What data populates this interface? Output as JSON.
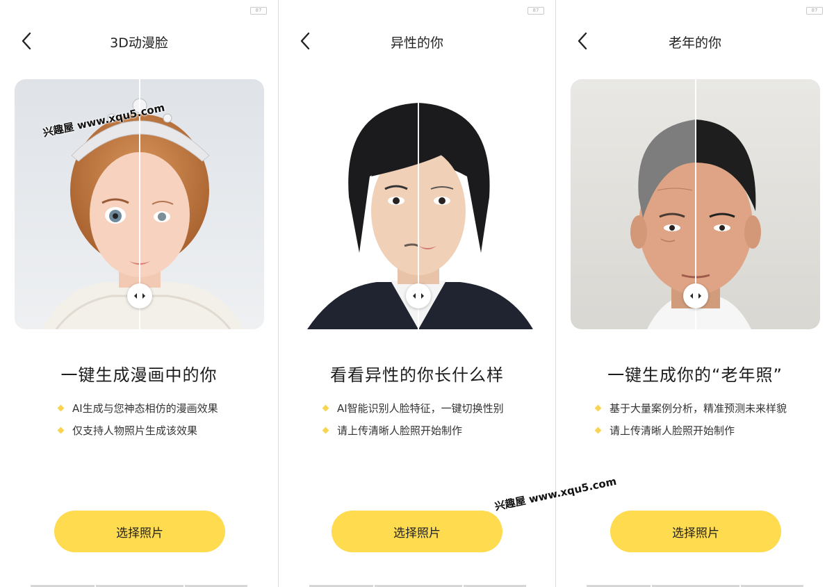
{
  "watermark_text": "兴趣屋 www.xqu5.com",
  "accent_color": "#fedb4f",
  "screens": [
    {
      "status_badge": "87",
      "title": "3D动漫脸",
      "headline": "一键生成漫画中的你",
      "bullets": [
        "AI生成与您神态相仿的漫画效果",
        "仅支持人物照片生成该效果"
      ],
      "button_label": "选择照片",
      "comparison_position": 0.5
    },
    {
      "status_badge": "87",
      "title": "异性的你",
      "headline": "看看异性的你长什么样",
      "bullets": [
        "AI智能识别人脸特征，一键切换性别",
        "请上传清晰人脸照开始制作"
      ],
      "button_label": "选择照片",
      "comparison_position": 0.5
    },
    {
      "status_badge": "87",
      "title": "老年的你",
      "headline": "一键生成你的“老年照”",
      "bullets": [
        "基于大量案例分析，精准预测未来样貌",
        "请上传清晰人脸照开始制作"
      ],
      "button_label": "选择照片",
      "comparison_position": 0.5
    }
  ]
}
